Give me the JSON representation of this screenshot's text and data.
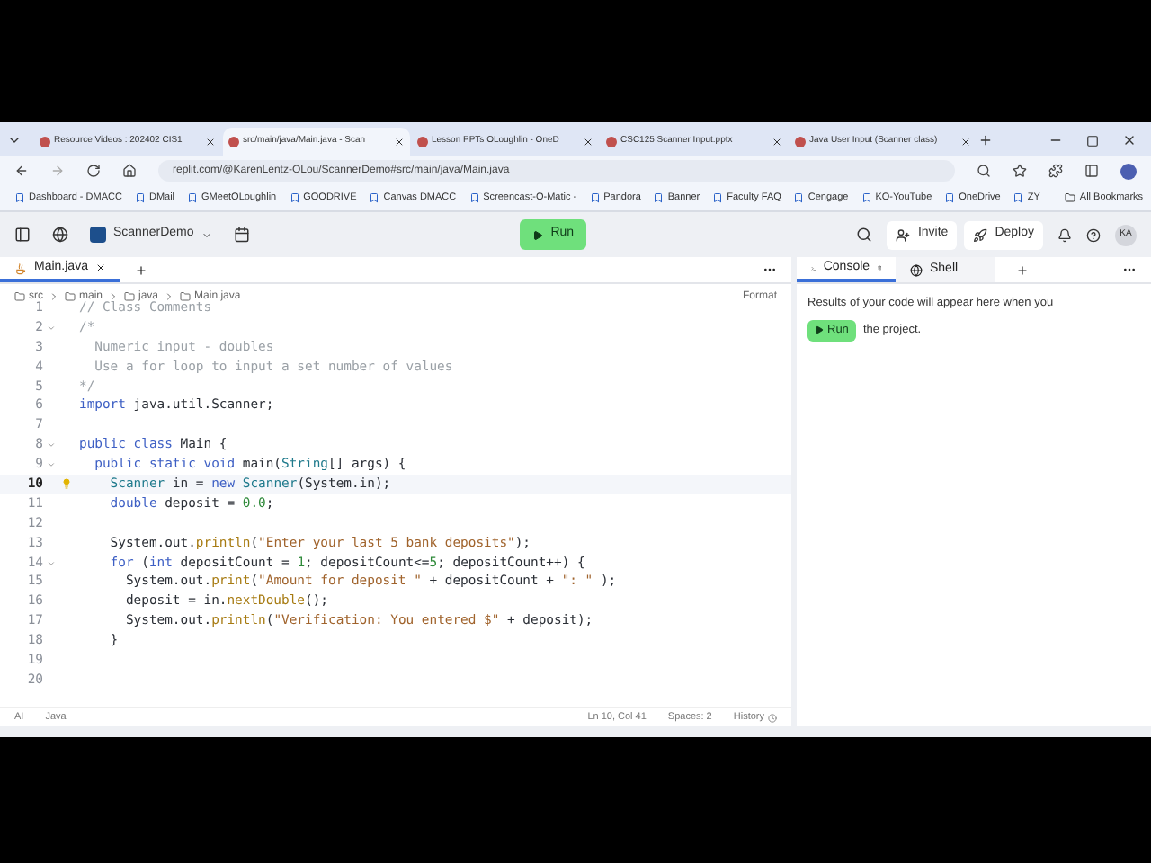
{
  "browser": {
    "tabs": [
      {
        "label": "Resource Videos : 202402 CIS1",
        "selected": false
      },
      {
        "label": "src/main/java/Main.java - Scan",
        "selected": true
      },
      {
        "label": "Lesson PPTs OLoughlin - OneD",
        "selected": false
      },
      {
        "label": "CSC125 Scanner Input.pptx",
        "selected": false
      },
      {
        "label": "Java User Input (Scanner class)",
        "selected": false
      }
    ],
    "url": "replit.com/@KarenLentz-OLou/ScannerDemo#src/main/java/Main.java",
    "bookmarks": [
      "Dashboard - DMACC",
      "DMail",
      "GMeetOLoughlin",
      "GOODRIVE",
      "Canvas DMACC",
      "Screencast-O-Matic -",
      "Pandora",
      "Banner",
      "Faculty FAQ",
      "Cengage",
      "KO-YouTube",
      "OneDrive",
      "ZY"
    ],
    "all_bookmarks": "All Bookmarks"
  },
  "header": {
    "project": "ScannerDemo",
    "run": "Run",
    "invite": "Invite",
    "deploy": "Deploy",
    "avatar": "KA"
  },
  "editor": {
    "tab": "Main.java",
    "breadcrumb": [
      "src",
      "main",
      "java",
      "Main.java"
    ],
    "format": "Format",
    "lines": [
      {
        "n": "1",
        "fold": false,
        "active": false,
        "segs": [
          {
            "kind": "comment",
            "text": "// Class Comments"
          }
        ]
      },
      {
        "n": "2",
        "fold": true,
        "active": false,
        "segs": [
          {
            "kind": "comment",
            "text": "/*"
          }
        ]
      },
      {
        "n": "3",
        "fold": false,
        "active": false,
        "segs": [
          {
            "kind": "comment",
            "text": "  Numeric input - doubles"
          }
        ]
      },
      {
        "n": "4",
        "fold": false,
        "active": false,
        "segs": [
          {
            "kind": "comment",
            "text": "  Use a for loop to input a set number of values"
          }
        ]
      },
      {
        "n": "5",
        "fold": false,
        "active": false,
        "segs": [
          {
            "kind": "comment",
            "text": "*/"
          }
        ]
      },
      {
        "n": "6",
        "fold": false,
        "active": false,
        "segs": [
          {
            "kind": "kw",
            "text": "import"
          },
          {
            "kind": "plain",
            "text": " java.util.Scanner;"
          }
        ]
      },
      {
        "n": "7",
        "fold": false,
        "active": false
      },
      {
        "n": "8",
        "fold": true,
        "active": false,
        "segs": [
          {
            "kind": "kw",
            "text": "public class"
          },
          {
            "kind": "plain",
            "text": " Main {"
          }
        ]
      },
      {
        "n": "9",
        "fold": true,
        "active": false,
        "segs": [
          {
            "kind": "kw",
            "text": "  public static void"
          },
          {
            "kind": "plain",
            "text": " main("
          },
          {
            "kind": "type",
            "text": "String"
          },
          {
            "kind": "plain",
            "text": "[] args) {"
          }
        ]
      },
      {
        "n": "10",
        "fold": false,
        "active": true,
        "segs": [
          {
            "kind": "type",
            "text": "    Scanner"
          },
          {
            "kind": "plain",
            "text": " in = "
          },
          {
            "kind": "kw",
            "text": "new"
          },
          {
            "kind": "type",
            "text": " Scanner"
          },
          {
            "kind": "plain",
            "text": "(System.in);"
          }
        ]
      },
      {
        "n": "11",
        "fold": false,
        "active": false,
        "segs": [
          {
            "kind": "kw",
            "text": "    double"
          },
          {
            "kind": "plain",
            "text": " deposit = "
          },
          {
            "kind": "num",
            "text": "0.0"
          },
          {
            "kind": "plain",
            "text": ";"
          }
        ]
      },
      {
        "n": "12",
        "fold": false,
        "active": false
      },
      {
        "n": "13",
        "fold": false,
        "active": false,
        "segs": [
          {
            "kind": "plain",
            "text": "    System.out."
          },
          {
            "kind": "fn",
            "text": "println"
          },
          {
            "kind": "plain",
            "text": "("
          },
          {
            "kind": "str",
            "text": "\"Enter your last 5 bank deposits\""
          },
          {
            "kind": "plain",
            "text": ");"
          }
        ]
      },
      {
        "n": "14",
        "fold": true,
        "active": false,
        "segs": [
          {
            "kind": "kw",
            "text": "    for"
          },
          {
            "kind": "plain",
            "text": " ("
          },
          {
            "kind": "kw",
            "text": "int"
          },
          {
            "kind": "plain",
            "text": " depositCount = "
          },
          {
            "kind": "num",
            "text": "1"
          },
          {
            "kind": "plain",
            "text": "; depositCount<="
          },
          {
            "kind": "num",
            "text": "5"
          },
          {
            "kind": "plain",
            "text": "; depositCount++) {"
          }
        ]
      },
      {
        "n": "15",
        "fold": false,
        "active": false,
        "segs": [
          {
            "kind": "plain",
            "text": "      System.out."
          },
          {
            "kind": "fn",
            "text": "print"
          },
          {
            "kind": "plain",
            "text": "("
          },
          {
            "kind": "str",
            "text": "\"Amount for deposit \""
          },
          {
            "kind": "plain",
            "text": " + depositCount + "
          },
          {
            "kind": "str",
            "text": "\": \""
          },
          {
            "kind": "plain",
            "text": " );"
          }
        ]
      },
      {
        "n": "16",
        "fold": false,
        "active": false,
        "segs": [
          {
            "kind": "plain",
            "text": "      deposit = in."
          },
          {
            "kind": "fn",
            "text": "nextDouble"
          },
          {
            "kind": "plain",
            "text": "();"
          }
        ]
      },
      {
        "n": "17",
        "fold": false,
        "active": false,
        "segs": [
          {
            "kind": "plain",
            "text": "      System.out."
          },
          {
            "kind": "fn",
            "text": "println"
          },
          {
            "kind": "plain",
            "text": "("
          },
          {
            "kind": "str",
            "text": "\"Verification: You entered $\""
          },
          {
            "kind": "plain",
            "text": " + deposit);"
          }
        ]
      },
      {
        "n": "18",
        "fold": false,
        "active": false,
        "segs": [
          {
            "kind": "plain",
            "text": "    }"
          }
        ]
      },
      {
        "n": "19",
        "fold": false,
        "active": false
      },
      {
        "n": "20",
        "fold": false,
        "active": false
      }
    ],
    "status": {
      "ai": "AI",
      "lang": "Java",
      "position": "Ln 10, Col 41",
      "spaces": "Spaces: 2",
      "history": "History"
    }
  },
  "console": {
    "tabs": [
      {
        "label": "Console",
        "selected": true
      },
      {
        "label": "Shell",
        "selected": false
      }
    ],
    "message_before": "Results of your code will appear here when you",
    "run": "Run",
    "message_after": "the project."
  }
}
